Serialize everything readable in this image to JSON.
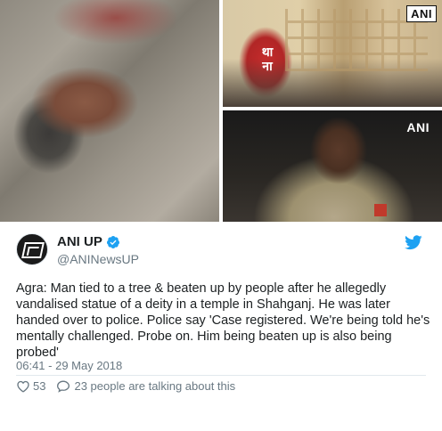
{
  "media": {
    "watermark_top": "ANI",
    "watermark_bottom": "ANI",
    "sign_text": "था\nना"
  },
  "author": {
    "display_name": "ANI UP",
    "handle": "@ANINewsUP"
  },
  "tweet": {
    "text": "Agra: Man tied to a tree & beaten up by people after he allegedly vandalised statue of a deity in a temple in Shahganj. He was later handed over to police. Police say 'Case registered. We're being told he's mentally challenged. Probe on. Him being beaten up is also being probed'",
    "timestamp": "06:41 - 29 May 2018"
  },
  "actions": {
    "likes": "53",
    "conversation": "23 people are talking about this"
  },
  "icons": {
    "verified": "verified-badge-icon",
    "brand": "twitter-bird-icon",
    "like": "heart-icon",
    "talk": "comment-icon"
  },
  "colors": {
    "brand_blue": "#1da1f2",
    "secondary_text": "#697882"
  }
}
